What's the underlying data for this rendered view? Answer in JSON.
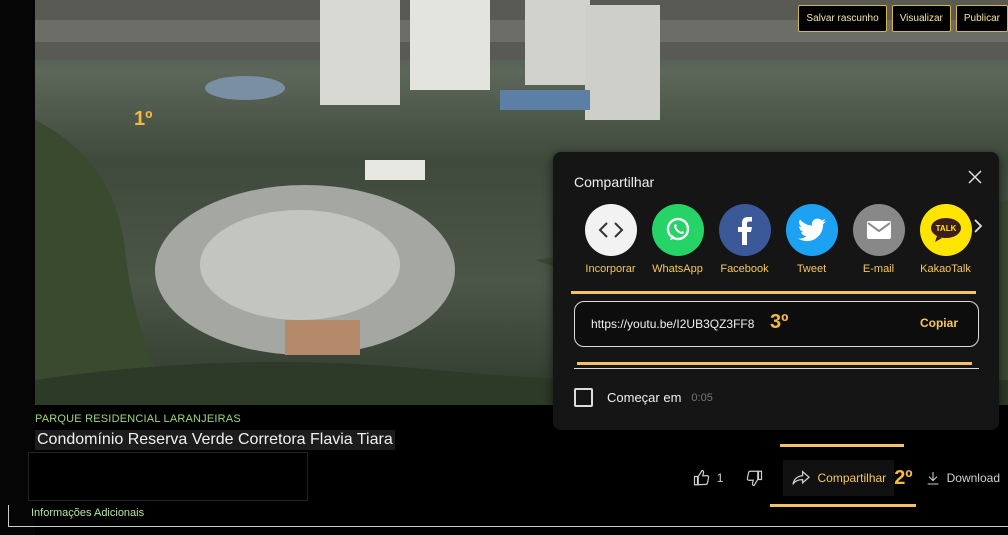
{
  "toolbar": {
    "save_draft": "Salvar rascunho",
    "preview": "Visualizar",
    "publish": "Publicar"
  },
  "annotations": {
    "first": "1º",
    "second": "2º",
    "third": "3º"
  },
  "video": {
    "subtitle": "PARQUE RESIDENCIAL LARANJEIRAS",
    "title": "Condomínio Reserva Verde Corretora Flavia Tiara"
  },
  "actions": {
    "likes": "1",
    "share": "Compartilhar",
    "download": "Download"
  },
  "share_panel": {
    "title": "Compartilhar",
    "options": [
      {
        "label": "Incorporar",
        "icon": "embed-icon",
        "color": "#f2f2f2"
      },
      {
        "label": "WhatsApp",
        "icon": "whatsapp-icon",
        "color": "#25d366"
      },
      {
        "label": "Facebook",
        "icon": "facebook-icon",
        "color": "#3b5998"
      },
      {
        "label": "Tweet",
        "icon": "twitter-icon",
        "color": "#1da1f2"
      },
      {
        "label": "E-mail",
        "icon": "email-icon",
        "color": "#888888"
      },
      {
        "label": "KakaoTalk",
        "icon": "kakaotalk-icon",
        "color": "#fee500"
      }
    ],
    "url": "https://youtu.be/I2UB3QZ3FF8",
    "copy": "Copiar",
    "start_at_label": "Começar em",
    "start_time": "0:05"
  },
  "footer": {
    "info": "Informações Adicionais"
  },
  "colors": {
    "accent": "#f5c85a",
    "annotation": "#f5b942"
  }
}
